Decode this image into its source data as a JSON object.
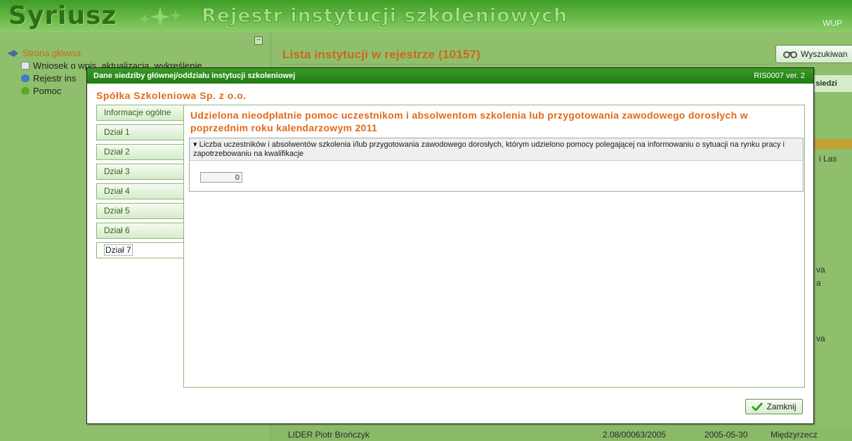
{
  "header": {
    "logo": "Syriusz",
    "title": "Rejestr instytucji szkoleniowych",
    "org": "WUP"
  },
  "sidebar": {
    "root": "Strona główna",
    "items": [
      {
        "label": "Wniosek o wpis, aktualizacja, wykreślenie"
      },
      {
        "label": "Rejestr ins"
      },
      {
        "label": "Pomoc"
      }
    ]
  },
  "main": {
    "list_title": "Lista instytucji w rejestrze (10157)",
    "search_button": "Wyszukiwan",
    "col_header": "ść siedzi",
    "side_cells": [
      "i Las",
      "va",
      "a",
      "va"
    ],
    "bottom_row": {
      "name": "LIDER Piotr Brończyk",
      "number": "2.08/00063/2005",
      "date": "2005-05-30",
      "city": "Międzyrzecz"
    }
  },
  "modal": {
    "title": "Dane siedziby głównej/oddziału instytucji szkoleniowej",
    "version": "RIS0007 ver. 2",
    "company": "Spółka Szkoleniowa Sp. z o.o.",
    "tabs": [
      "Informacje ogólne",
      "Dział 1",
      "Dział 2",
      "Dział 3",
      "Dział 4",
      "Dział 5",
      "Dział 6",
      "Dział 7"
    ],
    "active_tab": "Dział 7",
    "section_title": "Udzielona nieodpłatnie pomoc uczestnikom i absolwentom szkolenia lub przygotowania zawodowego dorosłych w poprzednim roku kalendarzowym 2011",
    "field_label": "Liczba uczestników i absolwentów szkolenia i/lub przygotowania zawodowego dorosłych, którym udzielono pomocy polegającej na informowaniu o sytuacji na rynku pracy i zapotrzebowaniu na kwalifikacje",
    "field_value": "0",
    "close_label": "Zamknij"
  },
  "colors": {
    "accent_orange": "#e06a1a",
    "titlebar_green": "#2a8c1b",
    "background_green": "#8fbf6c"
  },
  "icons": [
    "tree-arrow-icon",
    "form-edit-icon",
    "register-db-icon",
    "help-icon",
    "binoculars-icon",
    "checkmark-icon",
    "collapse-icon"
  ]
}
